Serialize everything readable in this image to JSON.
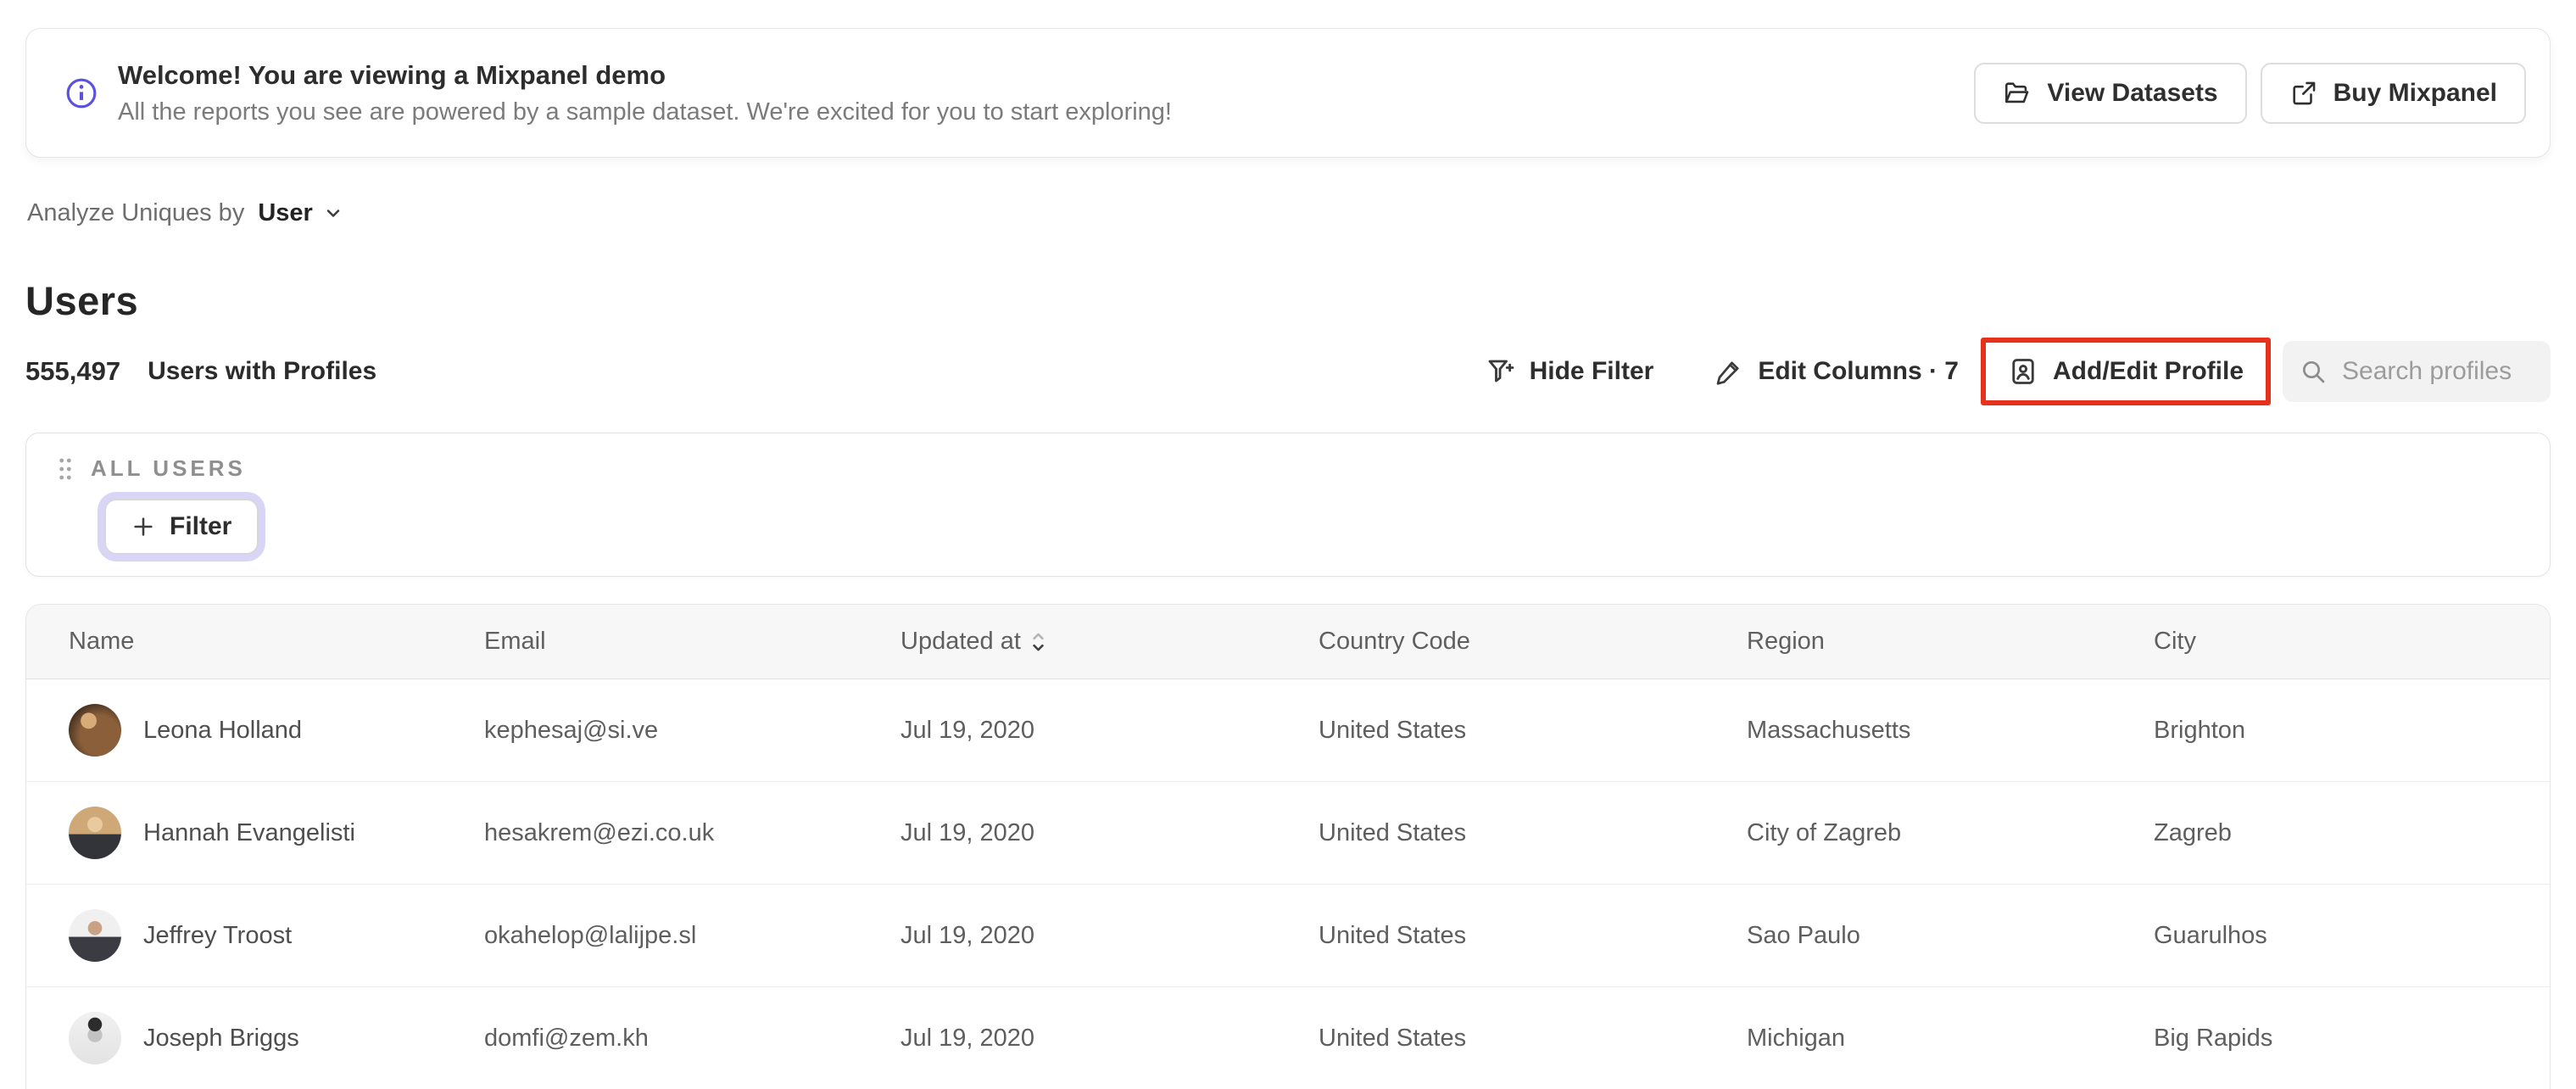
{
  "banner": {
    "title": "Welcome! You are viewing a Mixpanel demo",
    "subtitle": "All the reports you see are powered by a sample dataset. We're excited for you to start exploring!",
    "buttons": {
      "view_datasets": "View Datasets",
      "buy_mixpanel": "Buy Mixpanel"
    }
  },
  "analyze_bar": {
    "label": "Analyze Uniques by",
    "selected_value": "User"
  },
  "page": {
    "title": "Users",
    "profile_count": "555,497",
    "profile_count_label": "Users with Profiles"
  },
  "toolbar": {
    "hide_filter_label": "Hide Filter",
    "edit_columns_label": "Edit Columns · 7",
    "add_edit_profile_label": "Add/Edit Profile",
    "search_placeholder": "Search profiles",
    "highlight_color": "#e5321c"
  },
  "filter_panel": {
    "group_label": "ALL USERS",
    "filter_button_label": "Filter"
  },
  "table": {
    "columns": [
      "Name",
      "Email",
      "Updated at",
      "Country Code",
      "Region",
      "City"
    ],
    "sorted_column": "Updated at",
    "sort_direction": "descending",
    "rows": [
      {
        "name": "Leona Holland",
        "email": "kephesaj@si.ve",
        "updated_at": "Jul 19, 2020",
        "country_code": "United States",
        "region": "Massachusetts",
        "city": "Brighton"
      },
      {
        "name": "Hannah Evangelisti",
        "email": "hesakrem@ezi.co.uk",
        "updated_at": "Jul 19, 2020",
        "country_code": "United States",
        "region": "City of Zagreb",
        "city": "Zagreb"
      },
      {
        "name": "Jeffrey Troost",
        "email": "okahelop@lalijpe.sl",
        "updated_at": "Jul 19, 2020",
        "country_code": "United States",
        "region": "Sao Paulo",
        "city": "Guarulhos"
      },
      {
        "name": "Joseph Briggs",
        "email": "domfi@zem.kh",
        "updated_at": "Jul 19, 2020",
        "country_code": "United States",
        "region": "Michigan",
        "city": "Big Rapids"
      }
    ]
  },
  "colors": {
    "accent_purple": "#5b51e1",
    "highlight_red": "#e5321c",
    "header_bg": "#f7f7f8"
  }
}
